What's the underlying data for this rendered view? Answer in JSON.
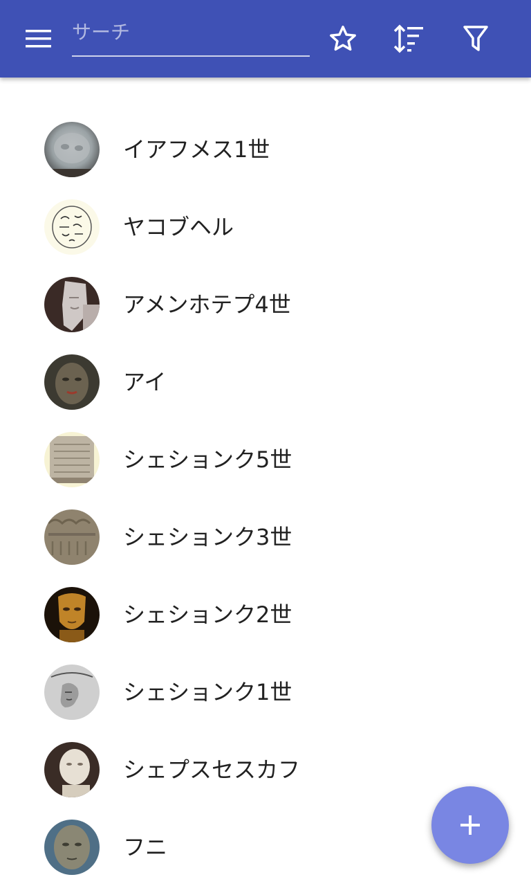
{
  "toolbar": {
    "search": {
      "value": "",
      "placeholder": "サーチ"
    },
    "icons": [
      "menu-icon",
      "star-outline-icon",
      "sort-icon",
      "filter-icon"
    ],
    "color": "#3f51b5"
  },
  "items": [
    {
      "label": "イアフメス1世",
      "avatar": "stone-head-portrait"
    },
    {
      "label": "ヤコブヘル",
      "avatar": "scarab-seal-inscription"
    },
    {
      "label": "アメンホテプ4世",
      "avatar": "akhenaten-statue"
    },
    {
      "label": "アイ",
      "avatar": "stone-face-bust"
    },
    {
      "label": "シェションク5世",
      "avatar": "inscribed-stele"
    },
    {
      "label": "シェションク3世",
      "avatar": "relief-carving"
    },
    {
      "label": "シェションク2世",
      "avatar": "golden-mask"
    },
    {
      "label": "シェションク1世",
      "avatar": "relief-profile-drawing"
    },
    {
      "label": "シェプスセスカフ",
      "avatar": "alabaster-head"
    },
    {
      "label": "フニ",
      "avatar": "granite-head"
    }
  ],
  "fab": {
    "icon": "plus-icon",
    "color": "#7986e3"
  }
}
